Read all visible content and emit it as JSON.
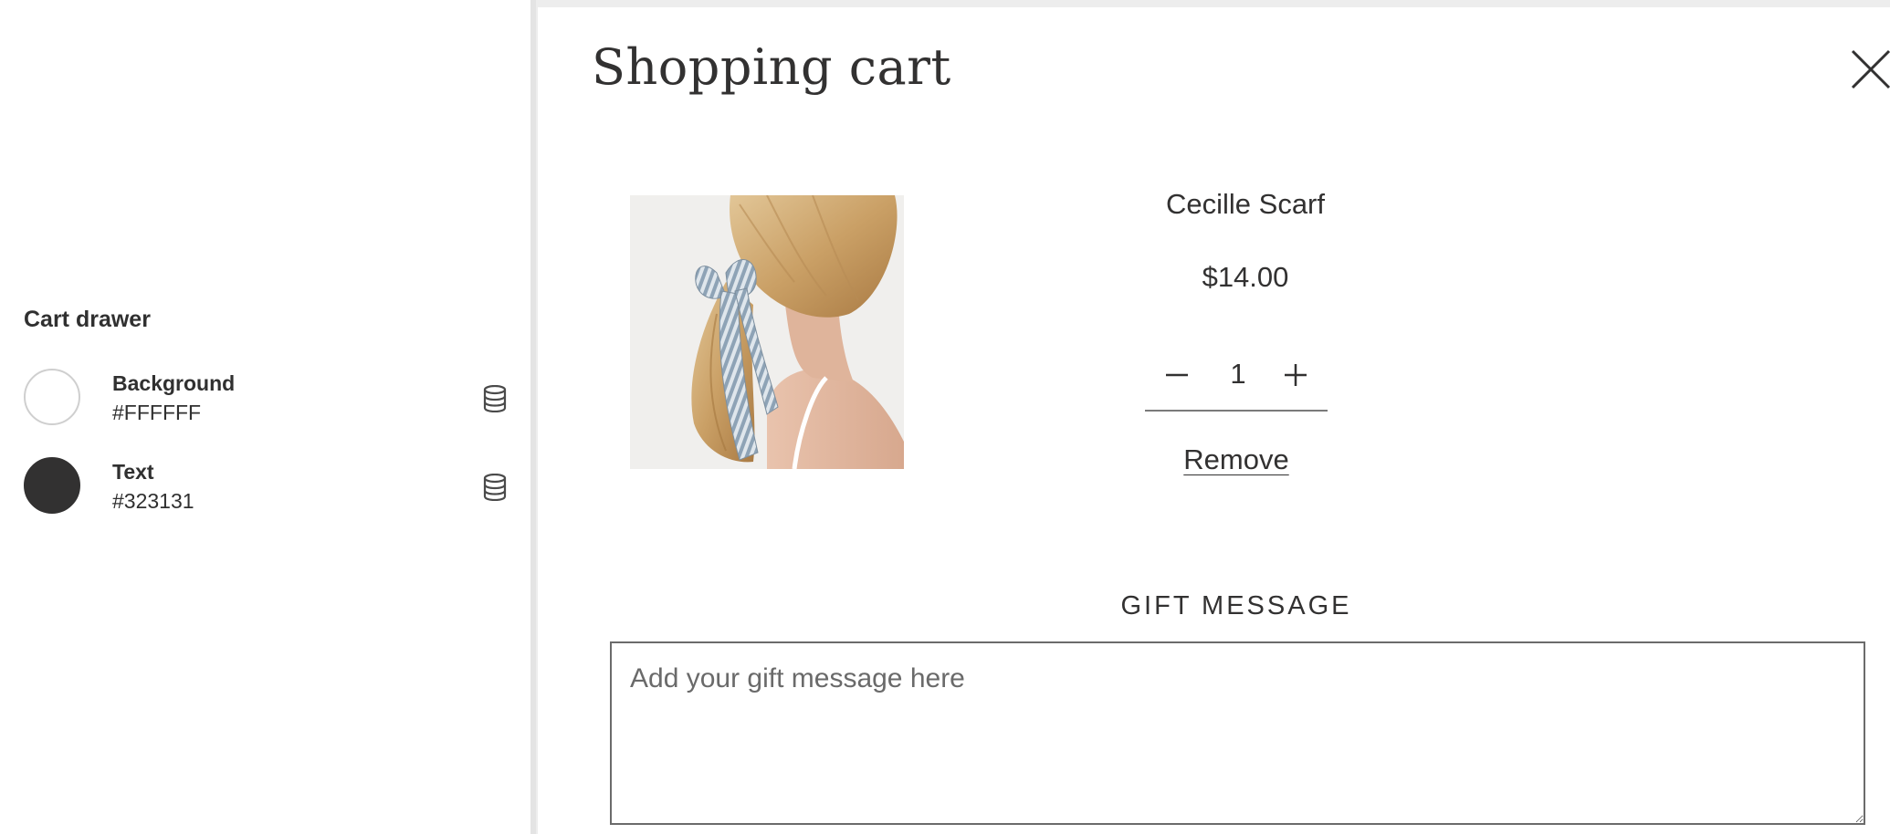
{
  "settings": {
    "section_title": "Cart drawer",
    "colors": [
      {
        "label": "Background",
        "hex_text": "#FFFFFF",
        "swatch": "#FFFFFF",
        "icon": "database-icon"
      },
      {
        "label": "Text",
        "hex_text": "#323131",
        "swatch": "#323131",
        "icon": "database-icon"
      }
    ]
  },
  "cart": {
    "title": "Shopping cart",
    "close_icon": "close-icon",
    "item": {
      "name": "Cecille Scarf",
      "price": "$14.00",
      "quantity": "1",
      "minus_icon": "minus-icon",
      "plus_icon": "plus-icon",
      "remove_label": "Remove"
    },
    "gift": {
      "heading": "GIFT MESSAGE",
      "placeholder": "Add your gift message here",
      "value": ""
    }
  },
  "theme": {
    "text_color": "#323131",
    "background": "#FFFFFF",
    "overlay": "#EDEDED"
  }
}
